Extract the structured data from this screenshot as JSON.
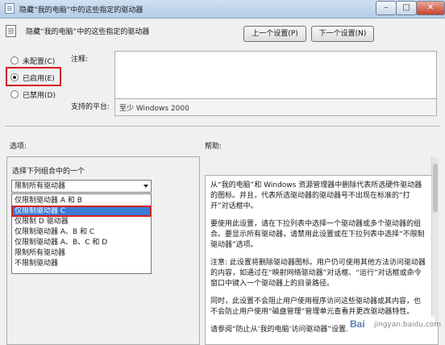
{
  "window": {
    "title": "隐藏“我的电脑”中的这些指定的驱动器",
    "minimize": "–",
    "maximize": "□",
    "close": "✕"
  },
  "header": {
    "title": "隐藏“我的电脑”中的这些指定的驱动器",
    "prev_button": "上一个设置(P)",
    "next_button": "下一个设置(N)"
  },
  "state": {
    "options": [
      {
        "label": "未配置(C)",
        "selected": false
      },
      {
        "label": "已启用(E)",
        "selected": true
      },
      {
        "label": "已禁用(D)",
        "selected": false
      }
    ]
  },
  "comment": {
    "label": "注释:",
    "value": ""
  },
  "platform": {
    "label": "支持的平台:",
    "value": "至少 Windows 2000"
  },
  "options_section": {
    "heading": "选项:",
    "combo_label": "选择下列组合中的一个",
    "selected_value": "限制所有驱动器",
    "items": [
      "仅限制驱动器 A 和 B",
      "仅限制驱动器 C",
      "仅限制 D 驱动器",
      "仅限制驱动器 A、B 和 C",
      "仅限制驱动器 A、B、C 和 D",
      "限制所有驱动器",
      "不限制驱动器"
    ],
    "highlighted_index": 1
  },
  "help_section": {
    "heading": "帮助:",
    "paragraphs": [
      "从“我的电脑”和 Windows 资源管理器中删除代表所选硬件驱动器的图标。并且，代表所选驱动器的驱动器号不出现在标准的“打开”对话框中。",
      "要使用此设置，请在下拉列表中选择一个驱动器或多个驱动器的组合。要显示所有驱动器，请禁用此设置或在下拉列表中选择“不限制驱动器”选项。",
      "注意: 此设置将删除驱动器图标。用户仍可使用其他方法访问驱动器的内容，如通过在“映射网络驱动器”对话框、“运行”对话框或命令窗口中键入一个驱动器上的目录路径。",
      "同时，此设置不会阻止用户使用程序访问这些驱动器或其内容，也不会防止用户使用“磁盘管理”管理单元查看并更改驱动器特性。",
      "请参阅“防止从‘我的电脑’访问驱动器”设置。"
    ]
  },
  "watermark": {
    "logo": "Bai",
    "text": "jingyan.baidu.com"
  },
  "colors": {
    "highlight_outline": "#d42121",
    "selection": "#3a7bd5"
  }
}
